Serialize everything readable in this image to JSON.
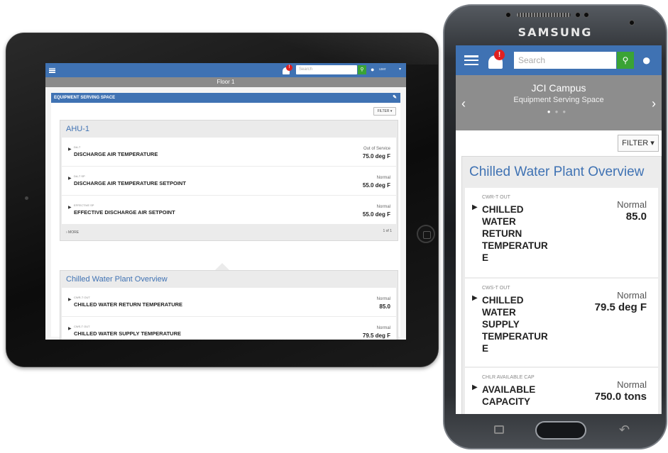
{
  "tablet": {
    "appbar": {
      "search_placeholder": "Search",
      "notification_count": "!",
      "user_name": "user"
    },
    "floor_title": "Floor 1",
    "panel_title": "EQUIPMENT SERVING SPACE",
    "filter_label": "FILTER ▾",
    "cards": [
      {
        "title": "AHU-1",
        "rows": [
          {
            "sub": "DA-T",
            "name": "DISCHARGE AIR TEMPERATURE",
            "status": "Out of Service",
            "value": "75.0 deg F"
          },
          {
            "sub": "DA-T SP",
            "name": "DISCHARGE AIR TEMPERATURE SETPOINT",
            "status": "Normal",
            "value": "55.0 deg F"
          },
          {
            "sub": "EFFECTIVE SP",
            "name": "EFFECTIVE DISCHARGE AIR SETPOINT",
            "status": "Normal",
            "value": "55.0 deg F"
          }
        ],
        "more_label": "› MORE",
        "page_label": "1 of 1"
      },
      {
        "title": "Chilled Water Plant Overview",
        "rows": [
          {
            "sub": "CWR-T OUT",
            "name": "CHILLED WATER RETURN TEMPERATURE",
            "status": "Normal",
            "value": "85.0"
          },
          {
            "sub": "CWS-T OUT",
            "name": "CHILLED WATER SUPPLY TEMPERATURE",
            "status": "Normal",
            "value": "79.5 deg F"
          }
        ]
      }
    ]
  },
  "phone": {
    "brand": "SAMSUNG",
    "appbar": {
      "search_placeholder": "Search",
      "notification_count": "!"
    },
    "banner": {
      "title": "JCI Campus",
      "subtitle": "Equipment Serving Space",
      "prev": "‹",
      "next": "›"
    },
    "filter_label": "FILTER ▾",
    "card": {
      "title": "Chilled Water Plant Overview",
      "rows": [
        {
          "sub": "CWR-T OUT",
          "name": "CHILLED WATER RETURN TEMPERATUR E",
          "status": "Normal",
          "value": "85.0"
        },
        {
          "sub": "CWS-T OUT",
          "name": "CHILLED WATER SUPPLY TEMPERATUR E",
          "status": "Normal",
          "value": "79.5 deg F"
        },
        {
          "sub": "CHLR AVAILABLE CAP",
          "name": "AVAILABLE CAPACITY",
          "status": "Normal",
          "value": "750.0 tons"
        }
      ]
    }
  },
  "colors": {
    "accent": "#3f72b3",
    "search_button": "#3aa335",
    "alert_badge": "#e02020",
    "banner_gray": "#8d8d8d"
  },
  "icons": {
    "menu": "hamburger-menu-icon",
    "bell": "bell-icon",
    "search": "search-icon",
    "user": "user-icon",
    "edit": "pencil-icon",
    "expand": "caret-right-icon"
  }
}
